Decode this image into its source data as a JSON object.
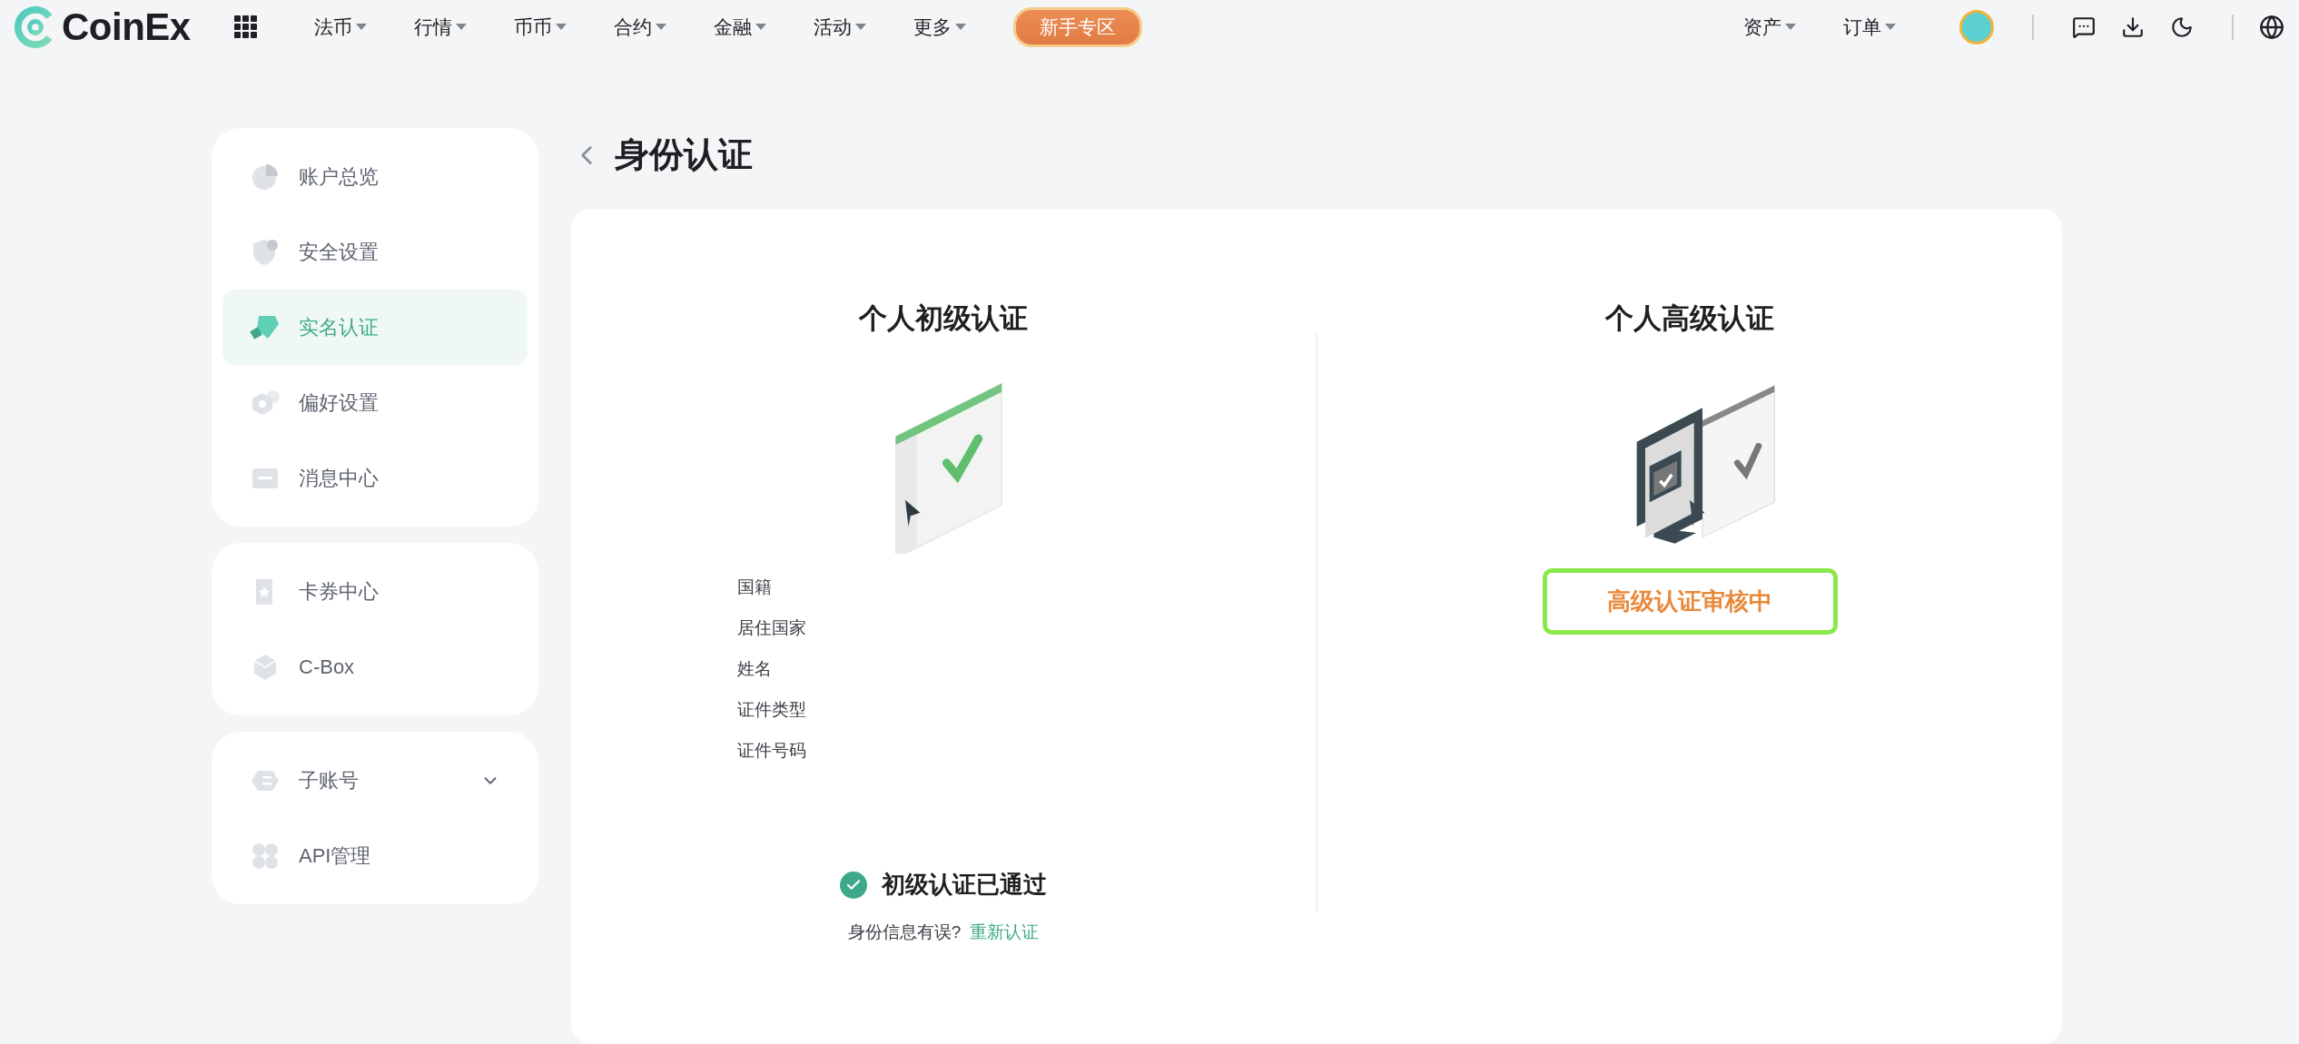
{
  "header": {
    "logo": "CoinEx",
    "nav": [
      {
        "label": "法币"
      },
      {
        "label": "行情"
      },
      {
        "label": "币币"
      },
      {
        "label": "合约"
      },
      {
        "label": "金融"
      },
      {
        "label": "活动"
      },
      {
        "label": "更多"
      }
    ],
    "badge": "新手专区",
    "right_menu": [
      {
        "label": "资产"
      },
      {
        "label": "订单"
      }
    ]
  },
  "sidebar": {
    "groups": [
      {
        "items": [
          {
            "label": "账户总览",
            "kind": "link",
            "selected": false
          },
          {
            "label": "安全设置",
            "kind": "link",
            "selected": false
          },
          {
            "label": "实名认证",
            "kind": "link",
            "selected": true
          },
          {
            "label": "偏好设置",
            "kind": "link",
            "selected": false
          },
          {
            "label": "消息中心",
            "kind": "link",
            "selected": false
          }
        ]
      },
      {
        "items": [
          {
            "label": "卡券中心",
            "kind": "link",
            "selected": false
          },
          {
            "label": "C-Box",
            "kind": "link",
            "selected": false
          }
        ]
      },
      {
        "items": [
          {
            "label": "子账号",
            "kind": "expandable",
            "selected": false
          },
          {
            "label": "API管理",
            "kind": "link",
            "selected": false
          }
        ]
      }
    ]
  },
  "page_title": "身份认证",
  "basic": {
    "title": "个人初级认证",
    "fields": [
      {
        "label": "国籍"
      },
      {
        "label": "居住国家"
      },
      {
        "label": "姓名"
      },
      {
        "label": "证件类型"
      },
      {
        "label": "证件号码"
      }
    ],
    "status": "初级认证已通过",
    "hint": "身份信息有误?",
    "link": "重新认证"
  },
  "advanced": {
    "title": "个人高级认证",
    "status": "高级认证审核中"
  }
}
